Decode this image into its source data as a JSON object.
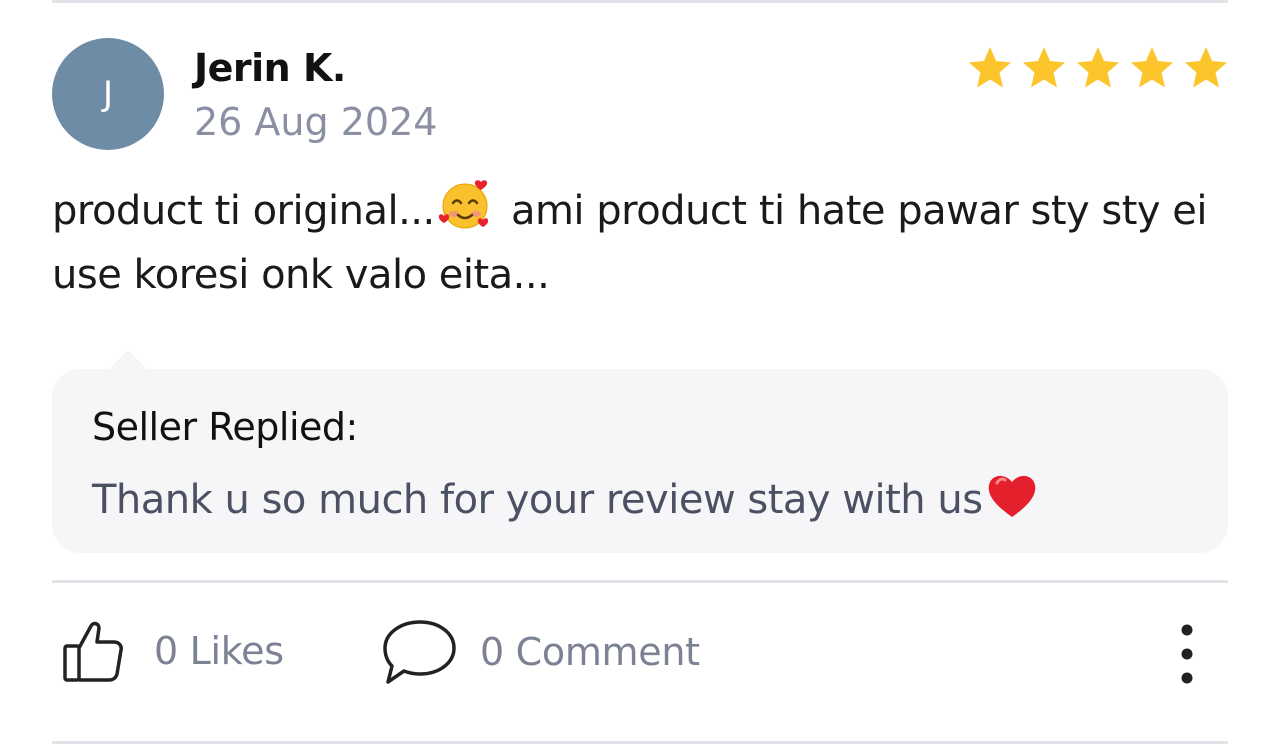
{
  "review": {
    "avatar_initial": "J",
    "reviewer_name": "Jerin K.",
    "date": "26 Aug 2024",
    "rating": 5,
    "rating_max": 5,
    "text_before_emoji": "product ti original...",
    "text_after_emoji": " ami product ti hate pawar sty sty ei use koresi onk valo eita...",
    "emoji_icon": "smiling-face-with-hearts-icon"
  },
  "seller_reply": {
    "title": "Seller Replied:",
    "text": "Thank u so much for your review stay with us",
    "emoji_icon": "red-heart-icon"
  },
  "actions": {
    "likes_label": "0 Likes",
    "comments_label": "0 Comment",
    "like_icon": "thumbs-up-icon",
    "comment_icon": "speech-bubble-icon",
    "more_icon": "vertical-ellipsis-icon"
  },
  "colors": {
    "avatar_bg": "#6f8ca7",
    "star": "#fbc52b",
    "reply_bg": "#f6f6f8",
    "muted_text": "#7c8193"
  }
}
